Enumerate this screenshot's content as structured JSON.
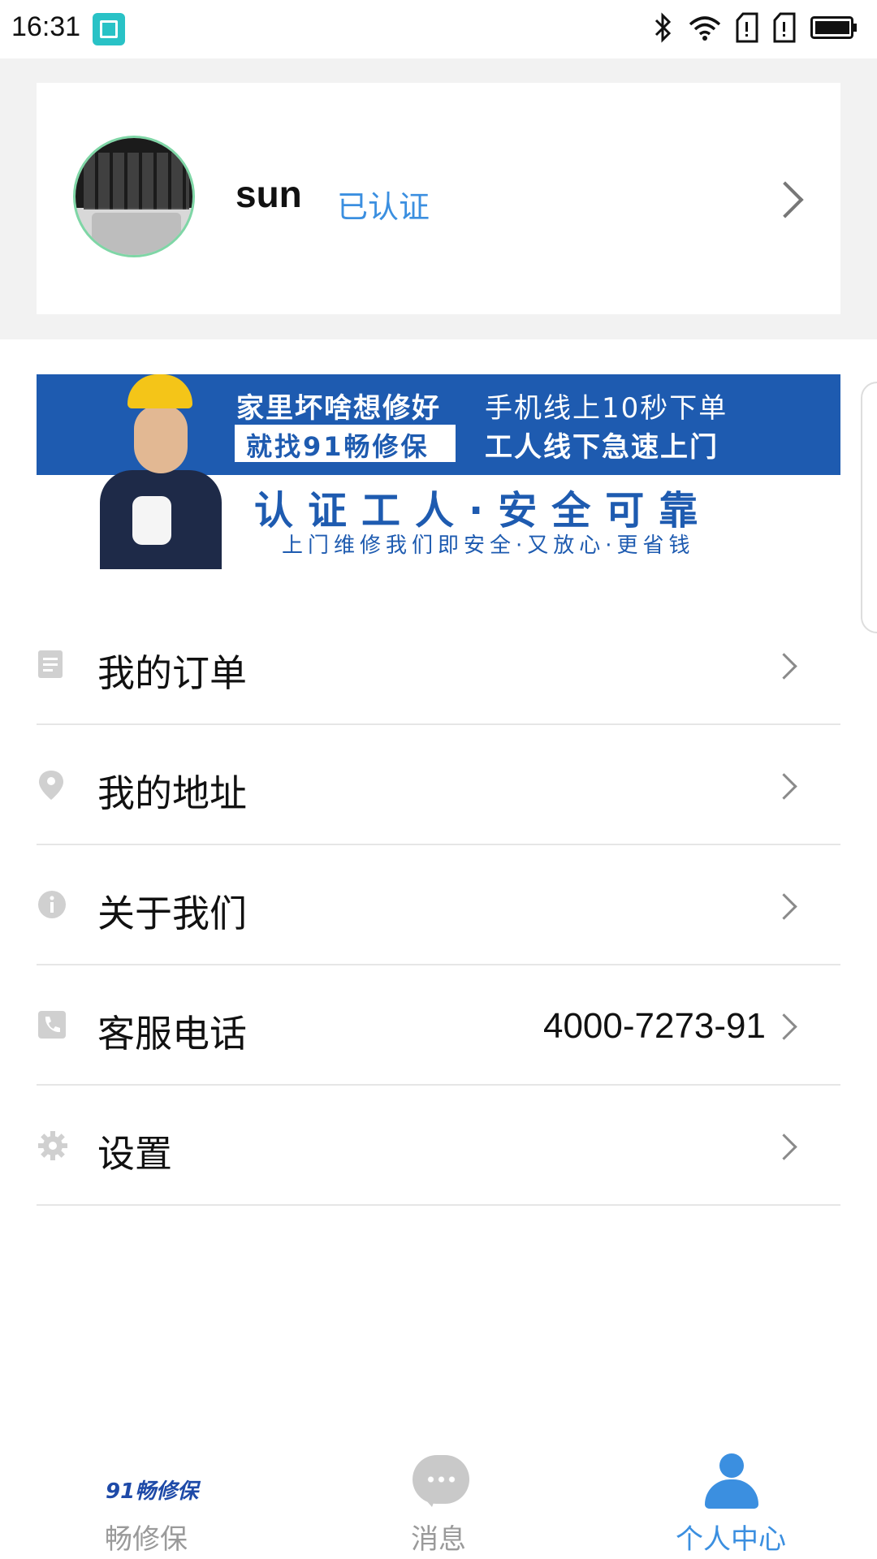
{
  "status_bar": {
    "time": "16:31"
  },
  "profile": {
    "username": "sun",
    "verified_label": "已认证"
  },
  "banner": {
    "line1_left": "家里坏啥想修好",
    "line2_left": "就找91畅修保",
    "line1_right": "手机线上10秒下单",
    "line2_right": "工人线下急速上门",
    "headline": "认证工人·安全可靠",
    "tagline": "上门维修我们即安全·又放心·更省钱",
    "badge_text": "91畅修保"
  },
  "menu": {
    "items": [
      {
        "label": "我的订单",
        "icon": "document-icon"
      },
      {
        "label": "我的地址",
        "icon": "location-pin-icon"
      },
      {
        "label": "关于我们",
        "icon": "info-icon"
      },
      {
        "label": "客服电话",
        "icon": "phone-icon",
        "value": "4000-7273-91"
      },
      {
        "label": "设置",
        "icon": "gear-icon"
      }
    ]
  },
  "tabbar": {
    "tabs": [
      {
        "label": "畅修保",
        "icon": "brand-logo-icon",
        "logo_text": "91畅修保"
      },
      {
        "label": "消息",
        "icon": "chat-bubble-icon"
      },
      {
        "label": "个人中心",
        "icon": "person-icon",
        "active": true
      }
    ]
  },
  "colors": {
    "accent": "#3b8fe0",
    "banner_blue": "#1e5bb0",
    "page_bg": "#f2f2f2",
    "icon_gray": "#c9c9c9"
  }
}
